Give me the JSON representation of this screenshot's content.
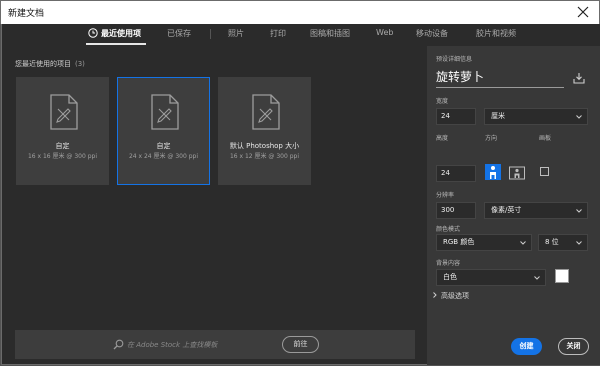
{
  "window": {
    "title": "新建文档"
  },
  "tabs": [
    {
      "label": "最近使用项",
      "active": true
    },
    {
      "label": "已保存"
    },
    {
      "label": "照片"
    },
    {
      "label": "打印"
    },
    {
      "label": "图稿和插图"
    },
    {
      "label": "Web"
    },
    {
      "label": "移动设备"
    },
    {
      "label": "胶片和视频"
    }
  ],
  "recent": {
    "label": "您最近使用的项目",
    "count": "(3)",
    "items": [
      {
        "name": "自定",
        "desc": "16 x 16 厘米 @ 300 ppi"
      },
      {
        "name": "自定",
        "desc": "24 x 24 厘米 @ 300 ppi",
        "selected": true
      },
      {
        "name": "默认 Photoshop 大小",
        "desc": "16 x 12 厘米 @ 300 ppi"
      }
    ]
  },
  "stock": {
    "placeholder": "在 Adobe Stock 上查找模板",
    "go_label": "前往"
  },
  "preset": {
    "section_label": "预设详细信息",
    "name": "旋转萝卜",
    "width_label": "宽度",
    "width": "24",
    "width_unit": "厘米",
    "height_label": "高度",
    "height": "24",
    "orientation_label": "方向",
    "artboard_label": "画板",
    "resolution_label": "分辨率",
    "resolution": "300",
    "resolution_unit": "像素/英寸",
    "color_mode_label": "颜色模式",
    "color_mode": "RGB 颜色",
    "bit_depth": "8 位",
    "background_label": "背景内容",
    "background": "白色",
    "background_color": "#ffffff",
    "advanced_label": "高级选项",
    "create_label": "创建",
    "close_label": "关闭"
  },
  "colors": {
    "accent": "#1473e6",
    "panel": "#383838",
    "background": "#2b2b2b"
  }
}
